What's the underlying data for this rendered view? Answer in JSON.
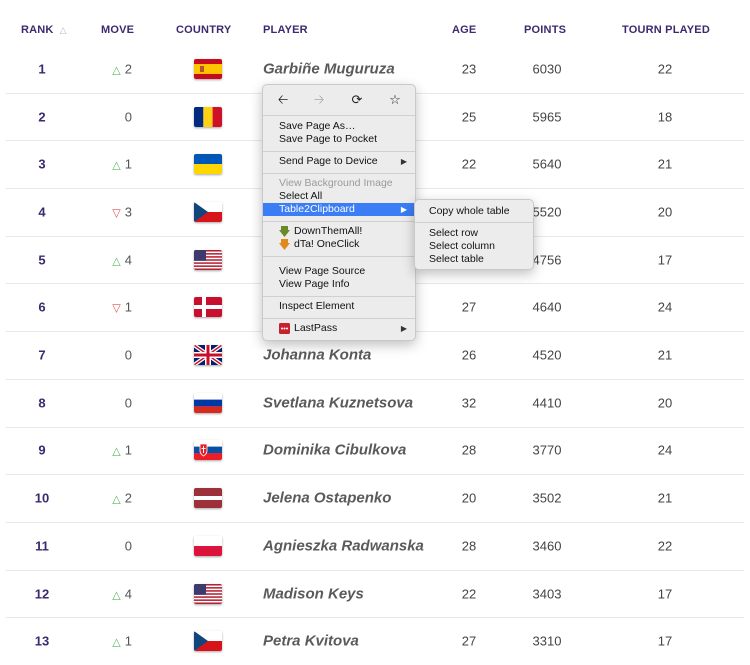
{
  "header": {
    "rank": "RANK",
    "sort_icon": "sort-triangle",
    "move": "MOVE",
    "country": "COUNTRY",
    "player": "PLAYER",
    "age": "AGE",
    "points": "POINTS",
    "tourn": "TOURN PLAYED"
  },
  "rows": [
    {
      "rank": "1",
      "move_dir": "up",
      "move": "2",
      "flag": "spain-flag",
      "player": "Garbiñe Muguruza",
      "age": "23",
      "points": "6030",
      "tourn": "22"
    },
    {
      "rank": "2",
      "move_dir": "none",
      "move": "0",
      "flag": "romania-flag",
      "player": "",
      "age": "25",
      "points": "5965",
      "tourn": "18"
    },
    {
      "rank": "3",
      "move_dir": "up",
      "move": "1",
      "flag": "ukraine-flag",
      "player": "",
      "age": "22",
      "points": "5640",
      "tourn": "21"
    },
    {
      "rank": "4",
      "move_dir": "down",
      "move": "3",
      "flag": "czech-flag",
      "player": "",
      "age": "",
      "points": "5520",
      "tourn": "20"
    },
    {
      "rank": "5",
      "move_dir": "up",
      "move": "4",
      "flag": "usa-flag",
      "player": "",
      "age": "",
      "points": "4756",
      "tourn": "17"
    },
    {
      "rank": "6",
      "move_dir": "down",
      "move": "1",
      "flag": "denmark-flag",
      "player": "",
      "age": "27",
      "points": "4640",
      "tourn": "24"
    },
    {
      "rank": "7",
      "move_dir": "none",
      "move": "0",
      "flag": "uk-flag",
      "player": "Johanna Konta",
      "age": "26",
      "points": "4520",
      "tourn": "21"
    },
    {
      "rank": "8",
      "move_dir": "none",
      "move": "0",
      "flag": "russia-flag",
      "player": "Svetlana Kuznetsova",
      "age": "32",
      "points": "4410",
      "tourn": "20"
    },
    {
      "rank": "9",
      "move_dir": "up",
      "move": "1",
      "flag": "slovakia-flag",
      "player": "Dominika Cibulkova",
      "age": "28",
      "points": "3770",
      "tourn": "24"
    },
    {
      "rank": "10",
      "move_dir": "up",
      "move": "2",
      "flag": "latvia-flag",
      "player": "Jelena Ostapenko",
      "age": "20",
      "points": "3502",
      "tourn": "21"
    },
    {
      "rank": "11",
      "move_dir": "none",
      "move": "0",
      "flag": "poland-flag",
      "player": "Agnieszka Radwanska",
      "age": "28",
      "points": "3460",
      "tourn": "22"
    },
    {
      "rank": "12",
      "move_dir": "up",
      "move": "4",
      "flag": "usa-flag",
      "player": "Madison Keys",
      "age": "22",
      "points": "3403",
      "tourn": "17"
    },
    {
      "rank": "13",
      "move_dir": "up",
      "move": "1",
      "flag": "czech-flag",
      "player": "Petra Kvitova",
      "age": "27",
      "points": "3310",
      "tourn": "17"
    }
  ],
  "context_menu": {
    "nav": {
      "back": "back-icon",
      "forward": "forward-icon",
      "reload": "reload-icon",
      "bookmark": "star-icon"
    },
    "save_page_as": "Save Page As…",
    "save_to_pocket": "Save Page to Pocket",
    "send_to_device": "Send Page to Device",
    "view_bg_image": "View Background Image",
    "select_all": "Select All",
    "table2clipboard": "Table2Clipboard",
    "downthemall": "DownThemAll!",
    "dta_oneclick": "dTa! OneClick",
    "view_source": "View Page Source",
    "view_info": "View Page Info",
    "inspect": "Inspect Element",
    "lastpass": "LastPass"
  },
  "submenu": {
    "copy_whole_table": "Copy whole table",
    "select_row": "Select row",
    "select_column": "Select column",
    "select_table": "Select table"
  },
  "colors": {
    "header_text": "#3c2a6e",
    "move_up": "#5cb85c",
    "move_down": "#d9534f",
    "menu_highlight": "#3a7df4"
  }
}
